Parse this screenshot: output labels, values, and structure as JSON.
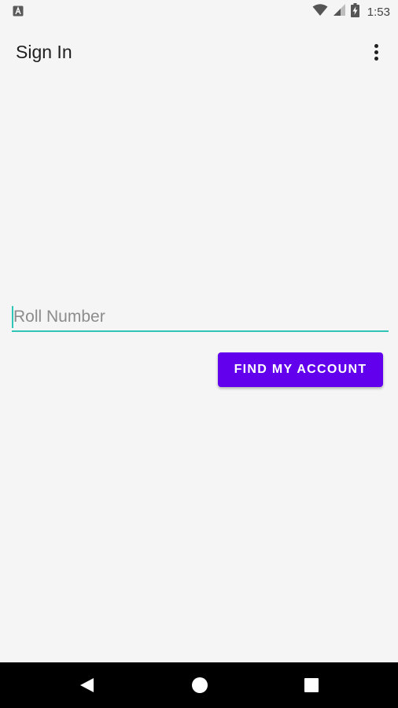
{
  "status_bar": {
    "time": "1:53",
    "icons": [
      "notification-a-icon",
      "wifi-icon",
      "cell-signal-icon",
      "battery-charging-icon"
    ]
  },
  "app_bar": {
    "title": "Sign In",
    "menu_icon": "overflow-menu-icon"
  },
  "form": {
    "roll_number": {
      "placeholder": "Roll Number",
      "value": ""
    },
    "submit_label": "FIND MY ACCOUNT"
  },
  "nav_bar": {
    "icons": [
      "back-icon",
      "home-icon",
      "recents-icon"
    ]
  },
  "colors": {
    "accent": "#6200ee",
    "field_underline": "#2ec4b6",
    "background": "#f5f5f5"
  }
}
